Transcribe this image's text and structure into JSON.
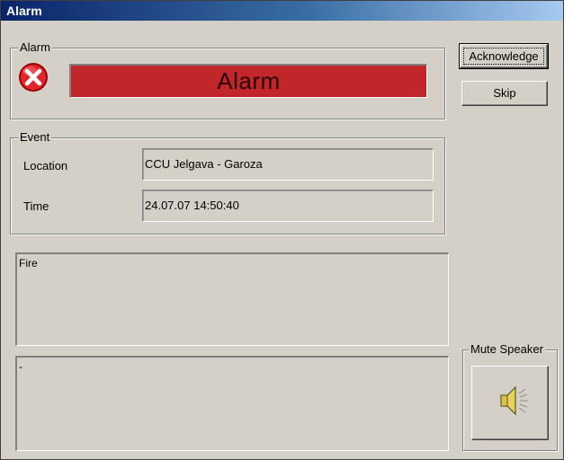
{
  "window": {
    "title": "Alarm"
  },
  "alarm_group": {
    "legend": "Alarm",
    "icon": "error-x-icon",
    "banner_text": "Alarm",
    "banner_color": "#c0262a"
  },
  "event_group": {
    "legend": "Event",
    "location_label": "Location",
    "location_value": "CCU Jelgava - Garoza",
    "time_label": "Time",
    "time_value": "24.07.07 14:50:40"
  },
  "description": {
    "primary_text": "Fire",
    "secondary_text": "-"
  },
  "actions": {
    "acknowledge_label": "Acknowledge",
    "skip_label": "Skip"
  },
  "mute_group": {
    "legend": "Mute Speaker",
    "icon": "speaker-icon"
  }
}
